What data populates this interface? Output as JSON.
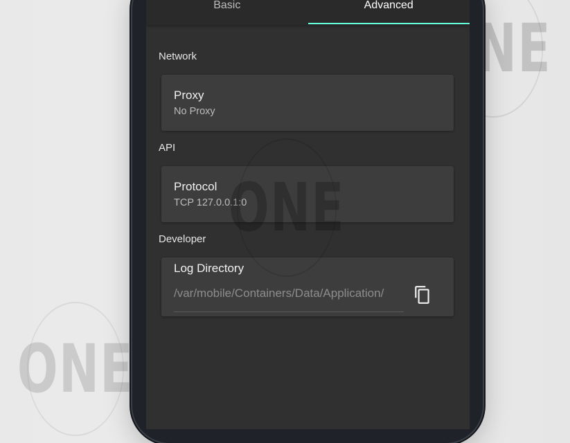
{
  "tabs": [
    {
      "label": "Basic",
      "active": false
    },
    {
      "label": "Advanced",
      "active": true
    }
  ],
  "sections": {
    "network": {
      "label": "Network",
      "item": {
        "title": "Proxy",
        "value": "No Proxy"
      }
    },
    "api": {
      "label": "API",
      "item": {
        "title": "Protocol",
        "value": "TCP 127.0.0.1:0"
      }
    },
    "developer": {
      "label": "Developer",
      "item": {
        "title": "Log Directory",
        "value": "/var/mobile/Containers/Data/Application/",
        "action_icon": "copy-icon"
      }
    }
  },
  "watermark": {
    "text": "ONE"
  },
  "colors": {
    "accent": "#64ffda",
    "screen_bg": "#303030",
    "card_bg": "#3d3d3d"
  }
}
